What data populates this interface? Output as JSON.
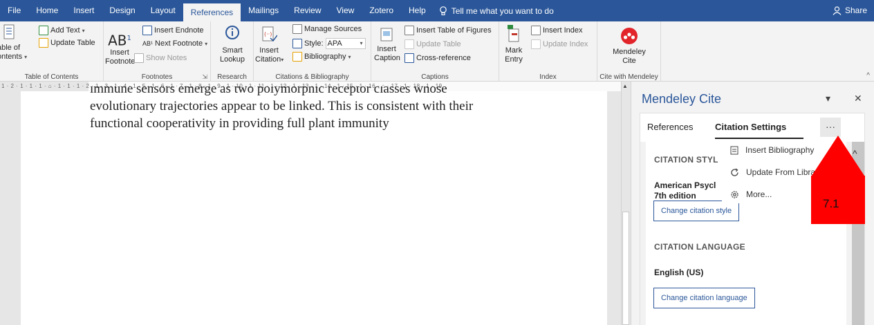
{
  "tabs": [
    {
      "label": "File"
    },
    {
      "label": "Home"
    },
    {
      "label": "Insert"
    },
    {
      "label": "Design"
    },
    {
      "label": "Layout"
    },
    {
      "label": "References"
    },
    {
      "label": "Mailings"
    },
    {
      "label": "Review"
    },
    {
      "label": "View"
    },
    {
      "label": "Zotero"
    },
    {
      "label": "Help"
    }
  ],
  "tell_me": "Tell me what you want to do",
  "share": "Share",
  "ribbon": {
    "toc": {
      "label1": "able of",
      "label2": "ontents",
      "add_text": "Add Text",
      "update_table": "Update Table",
      "group": "Table of Contents"
    },
    "footnotes": {
      "insert_footnote_1": "Insert",
      "insert_footnote_2": "Footnote",
      "insert_endnote": "Insert Endnote",
      "next_footnote": "Next Footnote",
      "show_notes": "Show Notes",
      "group": "Footnotes"
    },
    "research": {
      "smart_1": "Smart",
      "smart_2": "Lookup",
      "group": "Research"
    },
    "citations": {
      "insert_1": "Insert",
      "insert_2": "Citation",
      "manage_sources": "Manage Sources",
      "style_label": "Style:",
      "style_value": "APA",
      "bibliography": "Bibliography",
      "group": "Citations & Bibliography"
    },
    "captions": {
      "insert_1": "Insert",
      "insert_2": "Caption",
      "table_of_figures": "Insert Table of Figures",
      "update_table": "Update Table",
      "cross_reference": "Cross-reference",
      "group": "Captions"
    },
    "index": {
      "mark_1": "Mark",
      "mark_2": "Entry",
      "insert_index": "Insert Index",
      "update_index": "Update Index",
      "group": "Index"
    },
    "mendeley": {
      "label_1": "Mendeley",
      "label_2": "Cite",
      "group": "Cite with Mendeley"
    }
  },
  "ruler_text": "1 · 2 · 1 · 1 · 1 · ⌂ · 1 · 1 · 1 · 2 · 1 · 3 · 1 · 4 · 1 · 5 · 1 · 6 · 1 · 7 · 1 · 8 · 1 · 9 · 1 · 10 · 1 · 11 · 1 · 12 · 1 · 13 · 1 · 14 · 1 · 15 · 1 · 16 · ⌂ · 17 · 1 · 18 · 1 · 19",
  "document": {
    "line1": "immune sensors emerge as two polymorphic receptor classes whose",
    "line2": "evolutionary trajectories appear to be linked. This is consistent with their",
    "line3": "functional cooperativity in providing full plant immunity"
  },
  "pane": {
    "title": "Mendeley Cite",
    "tab_references": "References",
    "tab_citation_settings": "Citation Settings",
    "more": "···",
    "citation_style_heading": "CITATION STYL",
    "style_name": "American Psycl",
    "style_edition": "7th edition",
    "change_style_button": "Change citation style",
    "citation_language_heading": "CITATION LANGUAGE",
    "language_value": "English (US)",
    "change_language_button": "Change citation language"
  },
  "menu": {
    "insert_bibliography": "Insert Bibliography",
    "update_from_library": "Update From Librar",
    "more": "More..."
  },
  "annotation": {
    "label": "7.1"
  },
  "colors": {
    "word_blue": "#2b579a",
    "annotation_red": "#ff0000"
  }
}
